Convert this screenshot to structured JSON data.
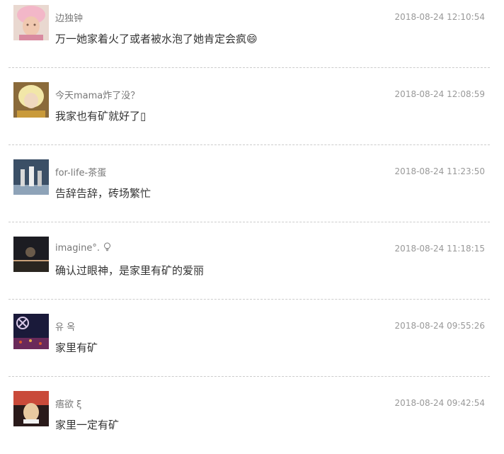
{
  "comments": [
    {
      "username": "边独钟",
      "timestamp": "2018-08-24 12:10:54",
      "content": "万一她家着火了或者被水泡了她肯定会疯😄",
      "avatar_colors": [
        "#f3b7c8",
        "#7a5a4a",
        "#d98aa0"
      ]
    },
    {
      "username": "今天mama炸了没？",
      "timestamp": "2018-08-24 12:08:59",
      "content": "我家也有矿就好了▯",
      "avatar_colors": [
        "#f2e7a8",
        "#c99a3a",
        "#6b5a3a"
      ]
    },
    {
      "username": "for-life-茶蛋",
      "timestamp": "2018-08-24 11:23:50",
      "content": "告辞告辞，砖场繁忙",
      "avatar_colors": [
        "#3b4f66",
        "#8ea3b8",
        "#d9d9d9"
      ]
    },
    {
      "username": "imagine°.",
      "timestamp": "2018-08-24 11:18:15",
      "content": "确认过眼神，是家里有矿的爱丽",
      "avatar_colors": [
        "#1c1c22",
        "#6a5a4a",
        "#c9a27a"
      ]
    },
    {
      "username": "유 옥",
      "timestamp": "2018-08-24 09:55:26",
      "content": "家里有矿",
      "avatar_colors": [
        "#1a1a3a",
        "#6a2a5a",
        "#d95a2a"
      ]
    },
    {
      "username": "痦欲 ξ",
      "timestamp": "2018-08-24 09:42:54",
      "content": "家里一定有矿",
      "avatar_colors": [
        "#c94a3a",
        "#2a1a1a",
        "#e8c9a0"
      ]
    }
  ]
}
